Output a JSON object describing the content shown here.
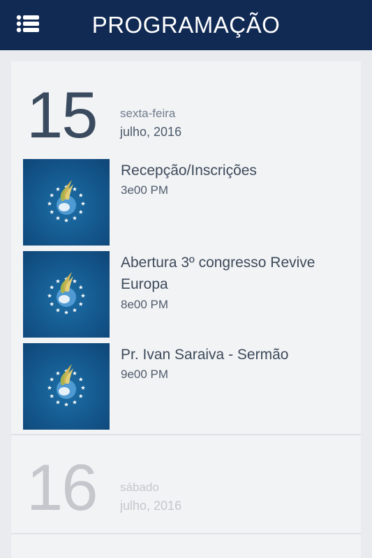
{
  "header": {
    "title": "PROGRAMAÇÃO",
    "menu_icon": "hamburger-menu-icon",
    "background": "#102a54"
  },
  "days": [
    {
      "day": "15",
      "weekday": "sexta-feira",
      "month_year": "julho, 2016",
      "events": [
        {
          "title": "Recepção/Inscrições",
          "time": "3e00 PM",
          "thumbnail_icon": "revive-europa-logo-icon"
        },
        {
          "title": "Abertura 3º congresso Revive Europa",
          "time": "8e00 PM",
          "thumbnail_icon": "revive-europa-logo-icon"
        },
        {
          "title": "Pr. Ivan Saraiva - Sermão",
          "time": "9e00 PM",
          "thumbnail_icon": "revive-europa-logo-icon"
        }
      ]
    },
    {
      "day": "16",
      "weekday": "sábado",
      "month_year": "julho, 2016",
      "events": []
    }
  ],
  "colors": {
    "accent": "#102a54",
    "thumb_blue": "#155c92",
    "text_dark": "#3d4a5a",
    "text_muted": "#c4c7cc"
  }
}
